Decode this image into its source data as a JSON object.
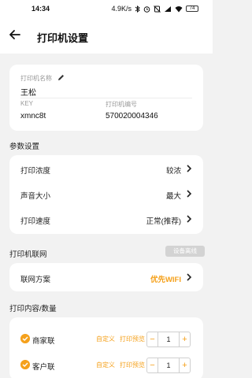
{
  "status_bar": {
    "time": "14:34",
    "net_speed": "4.9K/s",
    "battery": "74",
    "icons": [
      "bluetooth-icon",
      "alarm-icon",
      "mute-icon",
      "signal-icon",
      "wifi-icon",
      "battery-icon"
    ]
  },
  "header": {
    "title": "打印机设置",
    "back_icon": "arrow-left-icon"
  },
  "printer_info": {
    "name_label": "打印机名称",
    "name_value": "王松",
    "key_label": "KEY",
    "key_value": "xmnc8t",
    "number_label": "打印机编号",
    "number_value": "570020004346"
  },
  "params": {
    "section_title": "参数设置",
    "rows": [
      {
        "label": "打印浓度",
        "value": "较浓"
      },
      {
        "label": "声音大小",
        "value": "最大"
      },
      {
        "label": "打印速度",
        "value": "正常(推荐)"
      }
    ]
  },
  "network": {
    "section_title": "打印机联网",
    "badge": "设备离线",
    "row_label": "联网方案",
    "row_value": "优先WIFI"
  },
  "copies": {
    "section_title": "打印内容/数量",
    "rows": [
      {
        "label": "商家联",
        "customize": "自定义",
        "preview": "打印预览",
        "minus": "−",
        "quantity": "1",
        "plus": "+"
      },
      {
        "label": "客户联",
        "customize": "自定义",
        "preview": "打印预览",
        "minus": "−",
        "quantity": "1",
        "plus": "+"
      }
    ]
  },
  "colors": {
    "accent": "#f5a11c",
    "background": "#f2f2f2",
    "card": "#ffffff"
  }
}
